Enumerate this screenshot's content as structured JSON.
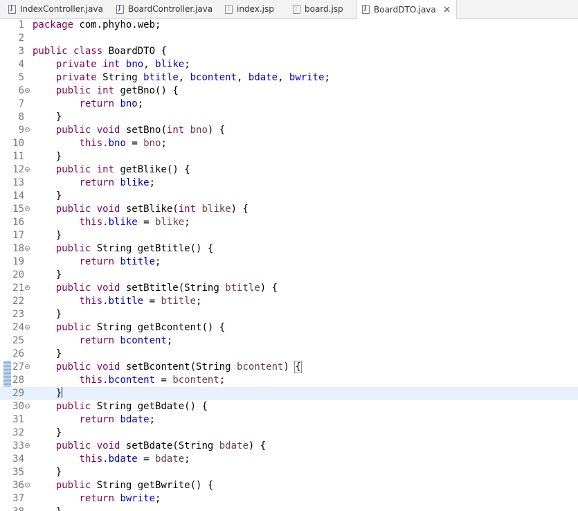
{
  "tabs": [
    {
      "label": "IndexController.java",
      "icon": "java-file-icon",
      "active": false
    },
    {
      "label": "BoardController.java",
      "icon": "java-file-icon",
      "active": false
    },
    {
      "label": "index.jsp",
      "icon": "jsp-file-icon",
      "active": false
    },
    {
      "label": "board.jsp",
      "icon": "jsp-file-icon",
      "active": false
    },
    {
      "label": "BoardDTO.java",
      "icon": "java-file-icon",
      "active": true,
      "close": "×"
    }
  ],
  "line_numbers": [
    "1",
    "2",
    "3",
    "4",
    "5",
    "6",
    "7",
    "8",
    "9",
    "10",
    "11",
    "12",
    "13",
    "14",
    "15",
    "16",
    "17",
    "18",
    "19",
    "20",
    "21",
    "22",
    "23",
    "24",
    "25",
    "26",
    "27",
    "28",
    "29",
    "30",
    "31",
    "32",
    "33",
    "34",
    "35",
    "36",
    "37",
    "38"
  ],
  "folding_lines": [
    "6",
    "9",
    "12",
    "15",
    "18",
    "21",
    "24",
    "27",
    "30",
    "33",
    "36"
  ],
  "current_line": "29",
  "colors": {
    "keyword": "#7f0055",
    "field": "#0000c0",
    "parameter": "#6a3e3e",
    "current_line_bg": "#e8f2fe",
    "line_number": "#787878"
  },
  "code": {
    "l1_kw": "package",
    "l1_rest": " com.phyho.web;",
    "l3_kw1": "public",
    "l3_kw2": "class",
    "l3_rest": " BoardDTO {",
    "l4_kw1": "private",
    "l4_kw2": "int",
    "l4_f1": "bno",
    "l4_sep": ", ",
    "l4_f2": "blike",
    "l4_end": ";",
    "l5_kw": "private",
    "l5_type": " String ",
    "l5_f1": "btitle",
    "l5_sep1": ", ",
    "l5_f2": "bcontent",
    "l5_sep2": ", ",
    "l5_f3": "bdate",
    "l5_sep3": ", ",
    "l5_f4": "bwrite",
    "l5_end": ";",
    "l6_kw1": "public",
    "l6_kw2": "int",
    "l6_rest": " getBno() {",
    "l7_kw": "return",
    "l7_f": "bno",
    "l7_end": ";",
    "close_brace": "}",
    "l9_kw1": "public",
    "l9_kw2": "void",
    "l9_m": " setBno(",
    "l9_kw3": "int",
    "l9_p": "bno",
    "l9_end": ") {",
    "l10_kw": "this",
    "l10_dot": ".",
    "l10_f": "bno",
    "l10_eq": " = ",
    "l10_p": "bno",
    "l10_end": ";",
    "l12_kw1": "public",
    "l12_kw2": "int",
    "l12_rest": " getBlike() {",
    "l13_kw": "return",
    "l13_f": "blike",
    "l13_end": ";",
    "l15_kw1": "public",
    "l15_kw2": "void",
    "l15_m": " setBlike(",
    "l15_kw3": "int",
    "l15_p": "blike",
    "l15_end": ") {",
    "l16_kw": "this",
    "l16_dot": ".",
    "l16_f": "blike",
    "l16_eq": " = ",
    "l16_p": "blike",
    "l16_end": ";",
    "l18_kw": "public",
    "l18_rest": " String getBtitle() {",
    "l19_kw": "return",
    "l19_f": "btitle",
    "l19_end": ";",
    "l21_kw1": "public",
    "l21_kw2": "void",
    "l21_m": " setBtitle(String ",
    "l21_p": "btitle",
    "l21_end": ") {",
    "l22_kw": "this",
    "l22_dot": ".",
    "l22_f": "btitle",
    "l22_eq": " = ",
    "l22_p": "btitle",
    "l22_end": ";",
    "l24_kw": "public",
    "l24_rest": " String getBcontent() {",
    "l25_kw": "return",
    "l25_f": "bcontent",
    "l25_end": ";",
    "l27_kw1": "public",
    "l27_kw2": "void",
    "l27_m": " setBcontent(String ",
    "l27_p": "bcontent",
    "l27_mid": ") ",
    "l27_brace": "{",
    "l28_kw": "this",
    "l28_dot": ".",
    "l28_f": "bcontent",
    "l28_eq": " = ",
    "l28_p": "bcontent",
    "l28_end": ";",
    "l30_kw": "public",
    "l30_rest": " String getBdate() {",
    "l31_kw": "return",
    "l31_f": "bdate",
    "l31_end": ";",
    "l33_kw1": "public",
    "l33_kw2": "void",
    "l33_m": " setBdate(String ",
    "l33_p": "bdate",
    "l33_end": ") {",
    "l34_kw": "this",
    "l34_dot": ".",
    "l34_f": "bdate",
    "l34_eq": " = ",
    "l34_p": "bdate",
    "l34_end": ";",
    "l36_kw": "public",
    "l36_rest": " String getBwrite() {",
    "l37_kw": "return",
    "l37_f": "bwrite",
    "l37_end": ";"
  }
}
